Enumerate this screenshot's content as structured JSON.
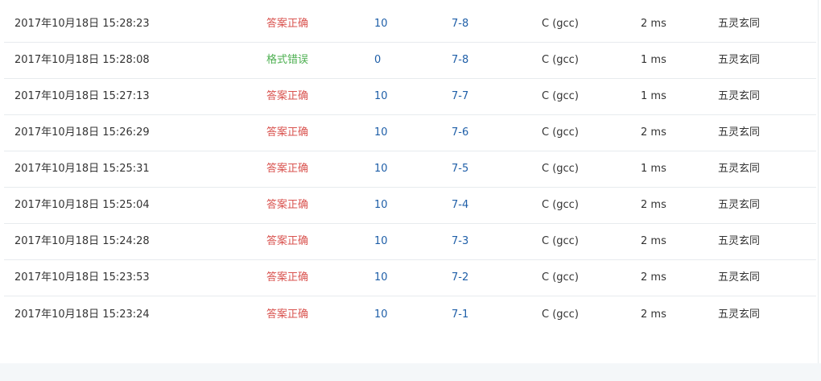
{
  "colors": {
    "accepted": "#d9534f",
    "format_error": "#4caf50",
    "link": "#1f5fa8"
  },
  "submissions": [
    {
      "time": "2017年10月18日 15:28:23",
      "status": "答案正确",
      "status_type": "ok",
      "score": "10",
      "problem": "7-8",
      "language": "C (gcc)",
      "time_used": "2 ms",
      "user": "五灵玄同"
    },
    {
      "time": "2017年10月18日 15:28:08",
      "status": "格式错误",
      "status_type": "fmt",
      "score": "0",
      "problem": "7-8",
      "language": "C (gcc)",
      "time_used": "1 ms",
      "user": "五灵玄同"
    },
    {
      "time": "2017年10月18日 15:27:13",
      "status": "答案正确",
      "status_type": "ok",
      "score": "10",
      "problem": "7-7",
      "language": "C (gcc)",
      "time_used": "1 ms",
      "user": "五灵玄同"
    },
    {
      "time": "2017年10月18日 15:26:29",
      "status": "答案正确",
      "status_type": "ok",
      "score": "10",
      "problem": "7-6",
      "language": "C (gcc)",
      "time_used": "2 ms",
      "user": "五灵玄同"
    },
    {
      "time": "2017年10月18日 15:25:31",
      "status": "答案正确",
      "status_type": "ok",
      "score": "10",
      "problem": "7-5",
      "language": "C (gcc)",
      "time_used": "1 ms",
      "user": "五灵玄同"
    },
    {
      "time": "2017年10月18日 15:25:04",
      "status": "答案正确",
      "status_type": "ok",
      "score": "10",
      "problem": "7-4",
      "language": "C (gcc)",
      "time_used": "2 ms",
      "user": "五灵玄同"
    },
    {
      "time": "2017年10月18日 15:24:28",
      "status": "答案正确",
      "status_type": "ok",
      "score": "10",
      "problem": "7-3",
      "language": "C (gcc)",
      "time_used": "2 ms",
      "user": "五灵玄同"
    },
    {
      "time": "2017年10月18日 15:23:53",
      "status": "答案正确",
      "status_type": "ok",
      "score": "10",
      "problem": "7-2",
      "language": "C (gcc)",
      "time_used": "2 ms",
      "user": "五灵玄同"
    },
    {
      "time": "2017年10月18日 15:23:24",
      "status": "答案正确",
      "status_type": "ok",
      "score": "10",
      "problem": "7-1",
      "language": "C (gcc)",
      "time_used": "2 ms",
      "user": "五灵玄同"
    }
  ]
}
